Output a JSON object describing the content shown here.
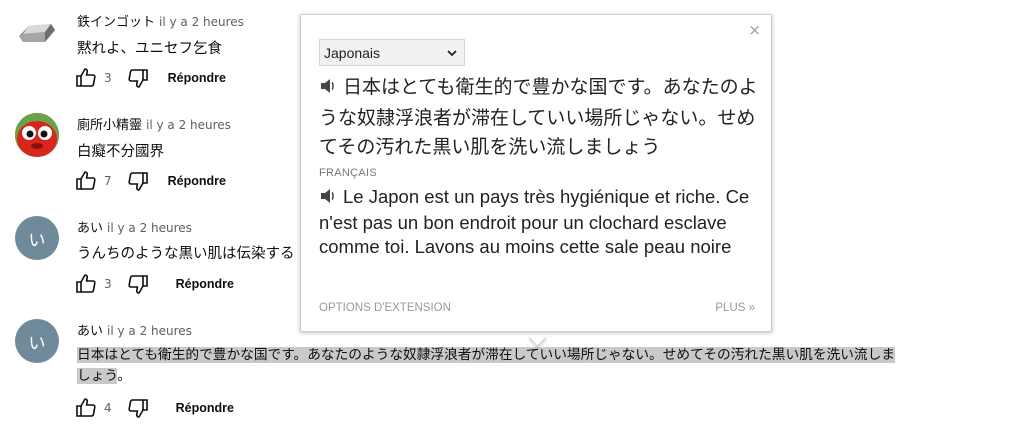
{
  "comments": [
    {
      "author": "鉄インゴット",
      "time": "il y a 2 heures",
      "text": "黙れよ、ユニセフ乞食",
      "likes": "3",
      "reply_label": "Répondre",
      "avatar": "iron-ingot-icon"
    },
    {
      "author": "廁所小精靈",
      "time": "il y a 2 heures",
      "text": "白癡不分國界",
      "likes": "7",
      "reply_label": "Répondre",
      "avatar": "red-creature-avatar"
    },
    {
      "author": "あい",
      "time": "il y a 2 heures",
      "text": "うんちのような黒い肌は伝染する",
      "likes": "3",
      "reply_label": "Répondre",
      "avatar_letter": "い"
    },
    {
      "author": "あい",
      "time": "il y a 2 heures",
      "text_line1": "日本はとても衛生的で豊かな国です。あなたのような奴隷浮浪者が滞在していい場所じゃない。せめてその汚れた黒い肌を洗い流しま",
      "text_line2_hl": "しょう",
      "text_line2_rest": "。",
      "likes": "4",
      "reply_label": "Répondre",
      "avatar_letter": "い"
    }
  ],
  "popup": {
    "close": "×",
    "source_language": "Japonais",
    "source_text": "日本はとても衛生的で豊かな国です。あなたのような奴隷浮浪者が滞在していい場所じゃない。せめてその汚れた黒い肌を洗い流しましょう",
    "target_label": "FRANÇAIS",
    "target_text": "Le Japon est un pays très hygiénique et riche. Ce n'est pas un bon endroit pour un clochard esclave comme toi. Lavons au moins cette sale peau noire",
    "options_label": "OPTIONS D'EXTENSION",
    "more_label": "PLUS »"
  },
  "colors": {
    "avatar_bg": "#6f8a9a",
    "highlight": "#c9c9c9"
  }
}
